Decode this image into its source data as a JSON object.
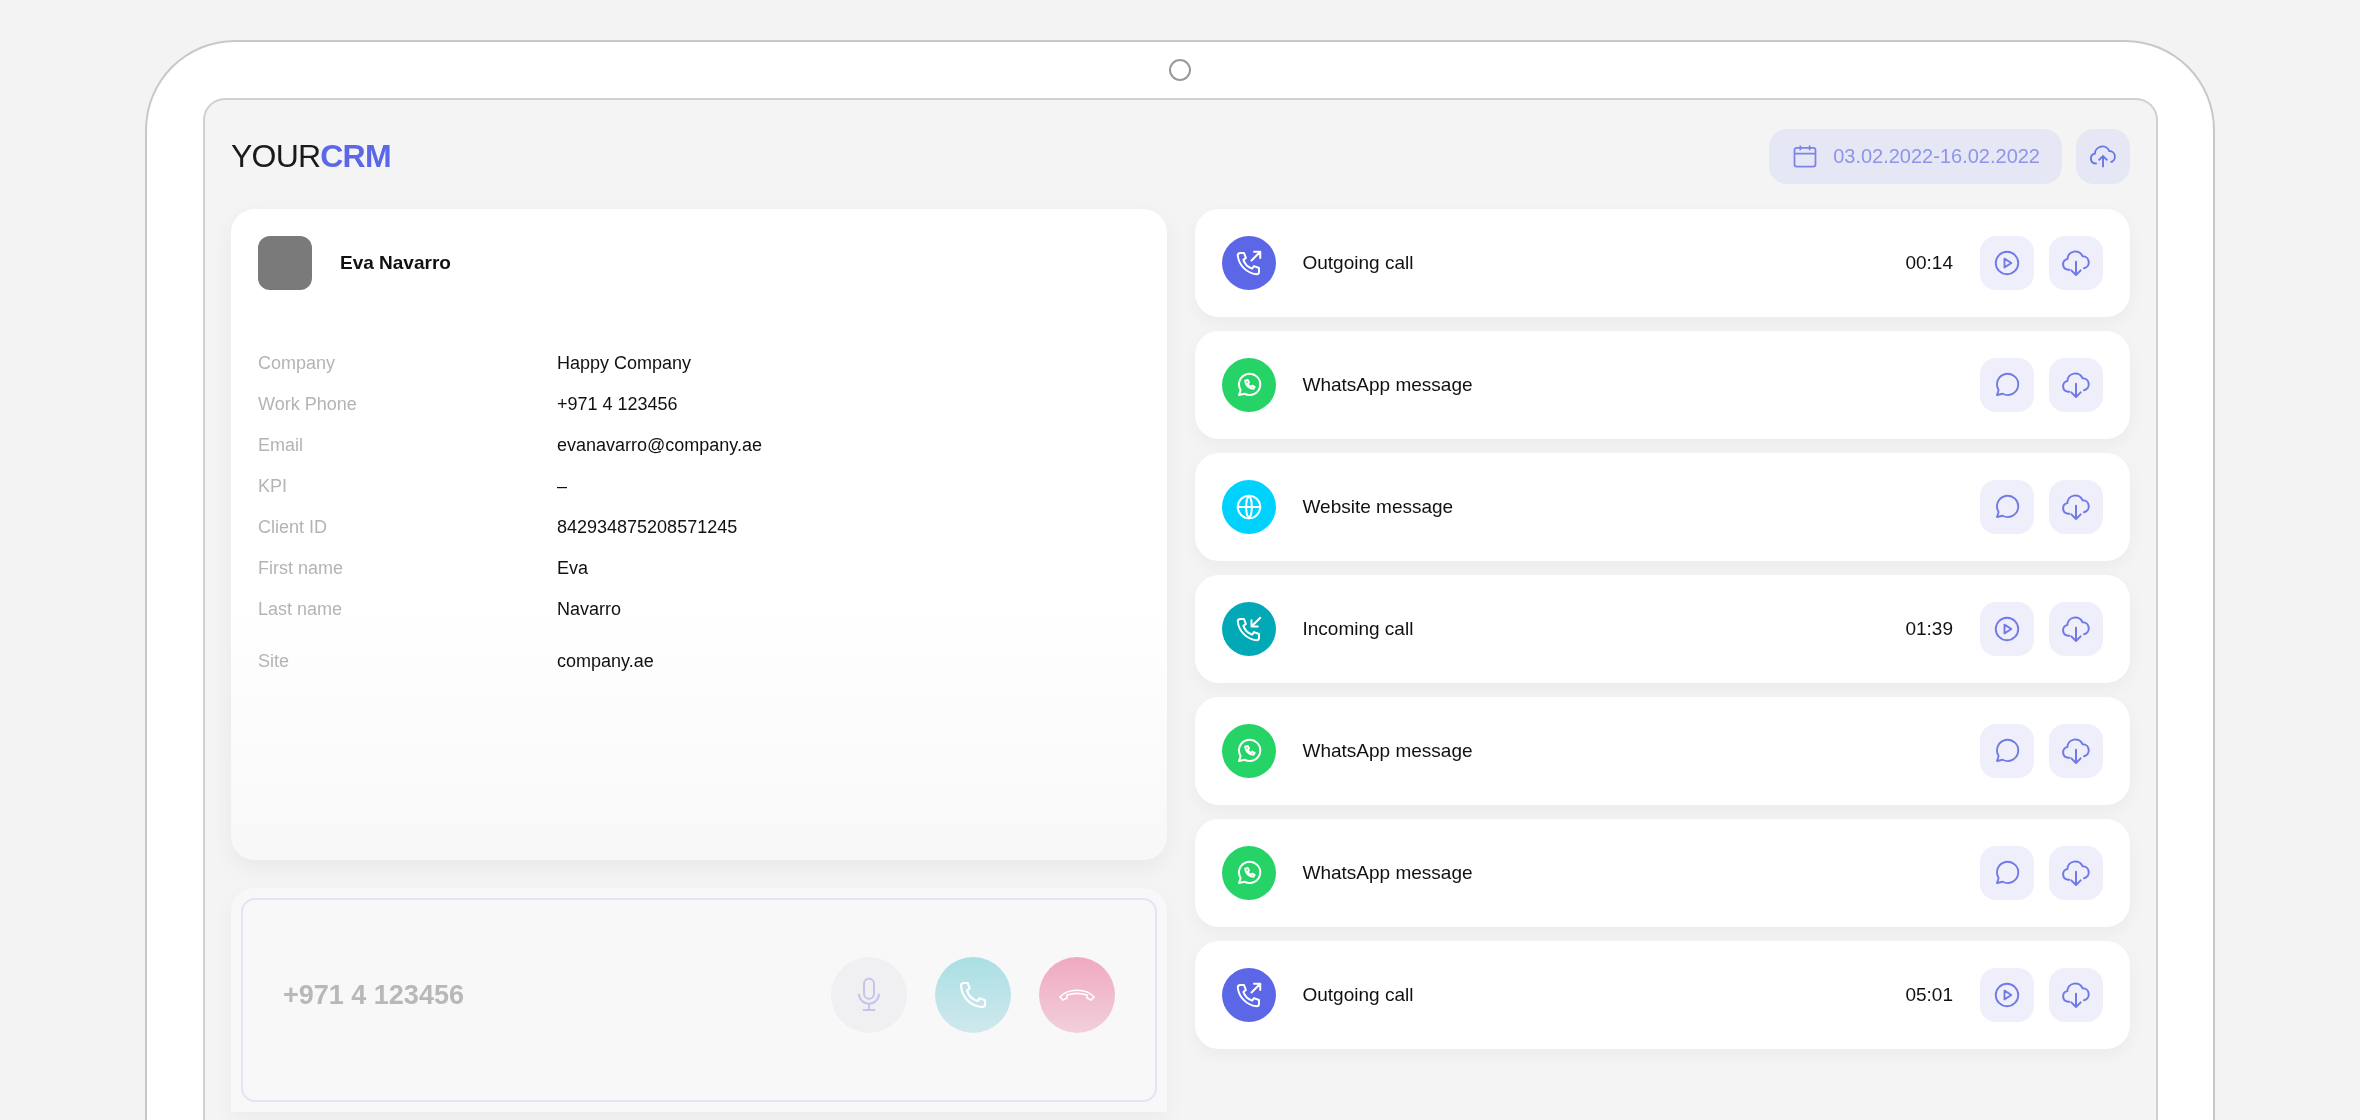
{
  "header": {
    "logo": "YOUR**CRM**",
    "date_range": "03.02.2022-16.02.2022"
  },
  "contact": {
    "name": "Eva Navarro",
    "fields": [
      {
        "label": "Company",
        "value": "Happy Company"
      },
      {
        "label": "Work Phone",
        "value": "+971 4 123456"
      },
      {
        "label": "Email",
        "value": "evanavarro@company.ae"
      },
      {
        "label": "KPI",
        "value": "–"
      },
      {
        "label": "Client ID",
        "value": "842934875208571245"
      },
      {
        "label": "First name",
        "value": "Eva"
      },
      {
        "label": "Last name",
        "value": "Navarro"
      },
      {
        "label": "Site",
        "value": "company.ae"
      }
    ]
  },
  "dialer": {
    "number": "+971 4 123456"
  },
  "activity": [
    {
      "kind": "outgoing_call",
      "label": "Outgoing call",
      "duration": "00:14"
    },
    {
      "kind": "whatsapp",
      "label": "WhatsApp message"
    },
    {
      "kind": "website",
      "label": "Website message"
    },
    {
      "kind": "incoming_call",
      "label": "Incoming call",
      "duration": "01:39"
    },
    {
      "kind": "whatsapp",
      "label": "WhatsApp message"
    },
    {
      "kind": "whatsapp",
      "label": "WhatsApp message"
    },
    {
      "kind": "outgoing_call",
      "label": "Outgoing call",
      "duration": "05:01"
    }
  ]
}
